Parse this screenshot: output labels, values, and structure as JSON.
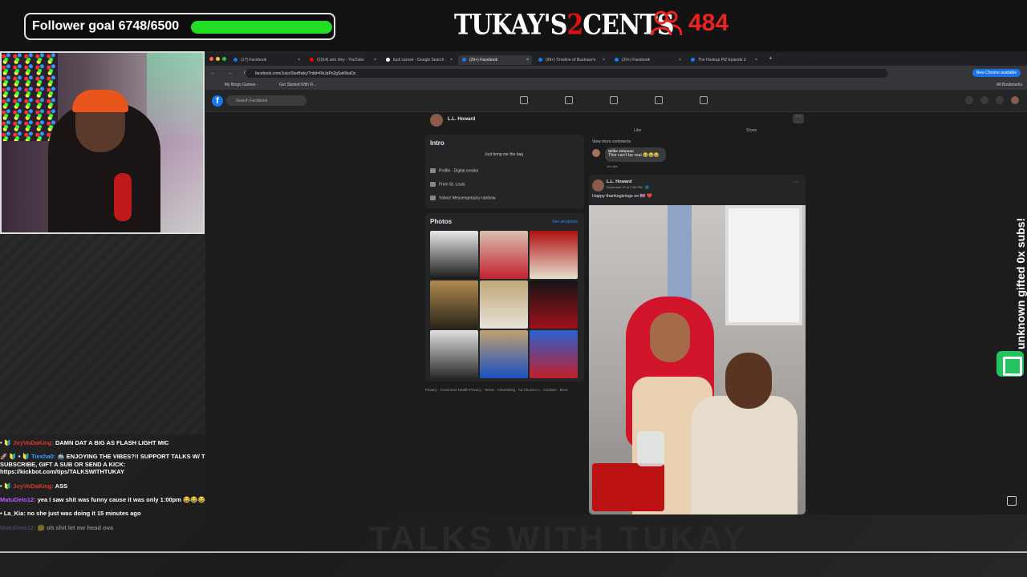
{
  "overlay": {
    "follower_goal_label": "Follower goal 6748/6500",
    "follower_goal_progress": 1.0,
    "brand": "TUKAY'S",
    "brand_two": "2",
    "brand_cents": "CENTS",
    "viewer_count": "484",
    "subs_text": "unknown gifted 0x subs!",
    "colors": {
      "goal_fill": "#22dd22",
      "viewers": "#ee2222",
      "subs_badge": "#25c260"
    }
  },
  "chat": [
    {
      "user": "JoyVoDaKing:",
      "color": "#e0342f",
      "text": "DAMN DAT A BIG AS FLASH LIGHT MIC",
      "prefix": "• 🔰 "
    },
    {
      "user": "Tiesha0:",
      "color": "#3aa0ff",
      "text": "🚢 ENJOYING THE VIBES?!! SUPPORT TALKS W/ TUKAY: SUBSCRIBE, GIFT A SUB OR SEND A KICK: https://kickbot.com/tips/TALKSWITHTUKAY",
      "prefix": "🚀 🔰 • 🔰 "
    },
    {
      "user": "JoyVoDaKing:",
      "color": "#e0342f",
      "text": "ASS",
      "prefix": "• 🔰 "
    },
    {
      "user": "MatuDelo12:",
      "color": "#b45cff",
      "text": "yea I saw shit was funny cause it was only 1:00pm 😂😂😂😂",
      "prefix": ""
    },
    {
      "user": "La_Kia:",
      "color": "#ffffff",
      "text": "no she just was doing it 15 minutes ago",
      "prefix": "• "
    },
    {
      "user": "MatuDelo12:",
      "color": "#8a5fb5",
      "text": "🤔 oh shit let me head ova",
      "prefix": ""
    }
  ],
  "browser": {
    "tabs": [
      {
        "label": "(17) Facebook",
        "active": false
      },
      {
        "label": "(1914) ann riley - YouTube",
        "active": false
      },
      {
        "label": "fuck cancer - Google Search",
        "active": false
      },
      {
        "label": "(20+) Facebook",
        "active": true
      },
      {
        "label": "(99+) Timeline of Illustrace's",
        "active": false
      },
      {
        "label": "(20+) Facebook",
        "active": false
      },
      {
        "label": "The Hookup Pt2 Episode 2",
        "active": false
      }
    ],
    "url": "facebook.com/JuiceStarBaby/?rdid=RkJaPs2gSaKlbaDz",
    "new_chrome": "New Chrome available",
    "bookmarks": [
      "My Bingo Games -",
      "Get Started With R..."
    ],
    "all_bookmarks": "All Bookmarks"
  },
  "facebook": {
    "logo": "f",
    "search_placeholder": "Search Facebook",
    "profile_name": "L.L. Howard",
    "intro": {
      "title": "Intro",
      "bio": "Just bring me the bag",
      "items": [
        "Profile · Digital creator",
        "From St. Louis",
        "Yahoo! Messengerjuicy rainbow"
      ]
    },
    "photos": {
      "title": "Photos",
      "see_all": "See all photos"
    },
    "footer": "Privacy · Consumer Health Privacy · Terms · Advertising · Ad Choices ▷ · Cookies · More",
    "comments": {
      "like": "Like",
      "share": "Share",
      "view_more": "View more comments",
      "author": "Willie Johnson",
      "text": "This can't be real 😂😂😂",
      "meta": "1w   Like"
    },
    "post": {
      "author": "L.L. Howard",
      "date": "November 27 at 7:59 PM · 🌐",
      "text": "Happy thanksgivings on 🇬🇧 ❤️",
      "dots": "···"
    }
  },
  "watermark": "TALKS WITH TUKAY"
}
